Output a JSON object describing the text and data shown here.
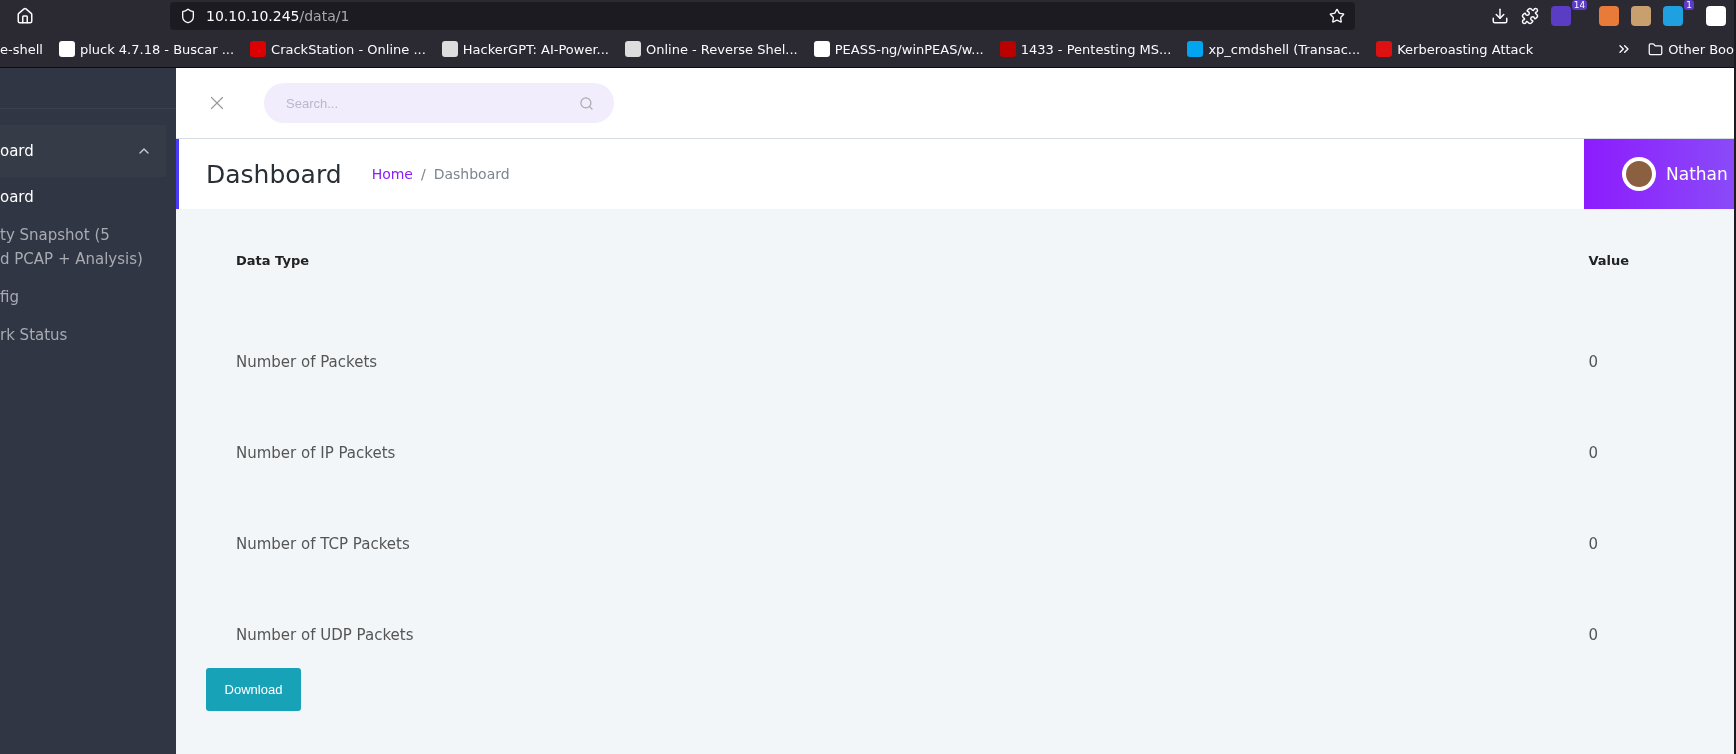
{
  "browser": {
    "url_host": "10.10.10.245",
    "url_path": "/data/1",
    "extension_badges": [
      "14",
      "1"
    ],
    "bookmarks": [
      "e-shell",
      "pluck 4.7.18 - Buscar ...",
      "CrackStation - Online ...",
      "HackerGPT: AI-Power...",
      "Online - Reverse Shel...",
      "PEASS-ng/winPEAS/w...",
      "1433 - Pentesting MS...",
      "xp_cmdshell (Transac...",
      "Kerberoasting Attack"
    ],
    "other_bookmarks": "Other Boo"
  },
  "sidebar": {
    "group": {
      "label": "oard",
      "expanded": true
    },
    "items": [
      {
        "label": "oard",
        "selected": true
      },
      {
        "label": "ty Snapshot (5\nd PCAP + Analysis)",
        "selected": false
      },
      {
        "label": "fig",
        "selected": false
      },
      {
        "label": "rk Status",
        "selected": false
      }
    ]
  },
  "search": {
    "placeholder": "Search..."
  },
  "header": {
    "title": "Dashboard",
    "breadcrumb": [
      "Home",
      "Dashboard"
    ],
    "breadcrumb_separator": "/",
    "user": "Nathan"
  },
  "table": {
    "columns": [
      "Data Type",
      "Value"
    ],
    "rows": [
      [
        "Number of Packets",
        "0"
      ],
      [
        "Number of IP Packets",
        "0"
      ],
      [
        "Number of TCP Packets",
        "0"
      ],
      [
        "Number of UDP Packets",
        "0"
      ]
    ]
  },
  "download": "Download"
}
